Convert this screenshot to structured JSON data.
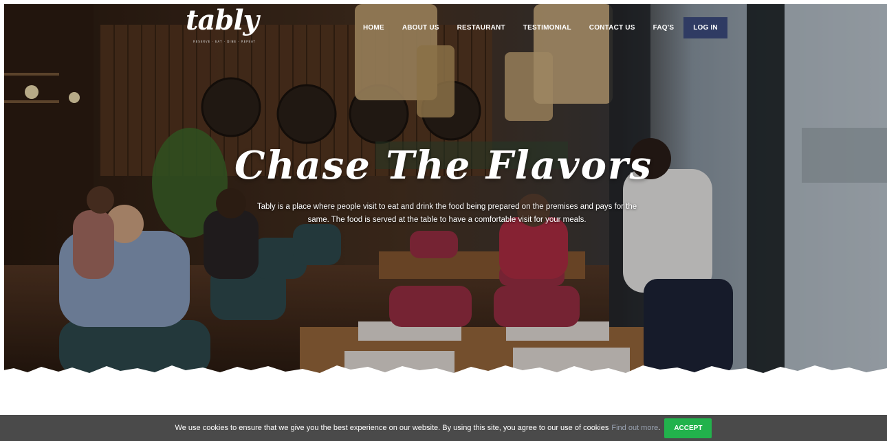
{
  "brand": {
    "logo_text": "tably",
    "logo_tagline": "RESERVE · EAT · DINE · REPEAT"
  },
  "nav": {
    "items": [
      "HOME",
      "ABOUT US",
      "RESTAURANT",
      "TESTIMONIAL",
      "CONTACT US",
      "FAQ'S"
    ],
    "login_label": "LOG IN"
  },
  "hero": {
    "headline": "Chase The Flavors",
    "tagline": "Tably is a place where people visit to eat and drink the food being prepared on the premises and pays for the same. The food is served at the table to have a comfortable visit for your meals."
  },
  "cookie": {
    "message": "We use cookies to ensure that we give you the best experience on our website. By using this site, you agree to our use of cookies",
    "link_label": "Find out more",
    "accept_label": "ACCEPT"
  },
  "colors": {
    "login_bg": "#2f3b63",
    "accept_bg": "#22b24c",
    "cookie_bg": "#3c3c3c"
  }
}
